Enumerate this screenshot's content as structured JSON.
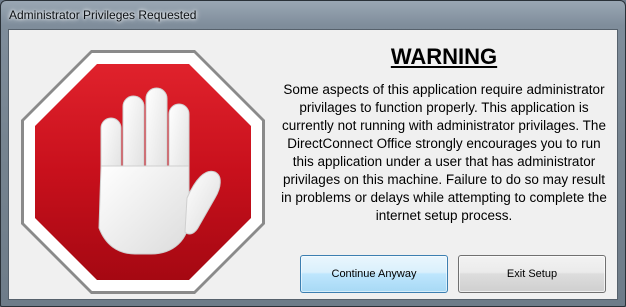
{
  "window": {
    "title": "Administrator Privileges Requested"
  },
  "dialog": {
    "heading": "WARNING",
    "message": "Some aspects of this application require administrator privilages to function properly.  This application is currently not running with administrator privilages.  The DirectConnect Office strongly encourages you to run this application under a user that has administrator privilages on this machine.  Failure to do so may result in problems or delays while attempting to complete the internet setup process.",
    "icon": "stop-hand-icon"
  },
  "buttons": {
    "continue_label": "Continue Anyway",
    "exit_label": "Exit Setup"
  },
  "colors": {
    "stop_red": "#c8101c",
    "stop_border": "#ffffff",
    "hand": "#ffffff"
  }
}
